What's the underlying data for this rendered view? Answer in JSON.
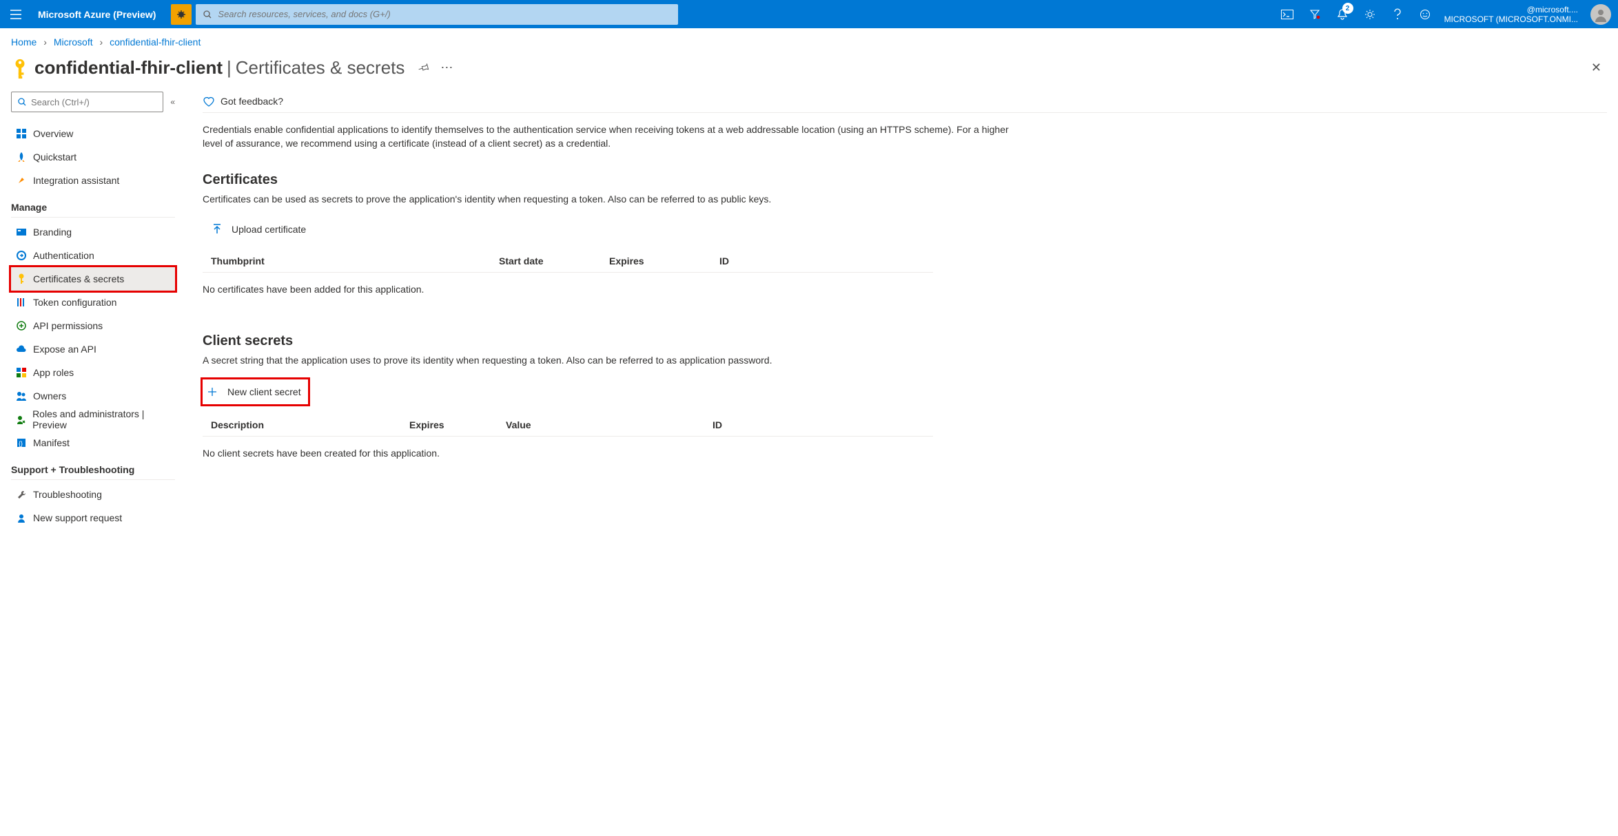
{
  "topbar": {
    "brand": "Microsoft Azure (Preview)",
    "search_placeholder": "Search resources, services, and docs (G+/)",
    "notification_count": "2",
    "account_line1": "@microsoft....",
    "account_line2": "MICROSOFT (MICROSOFT.ONMI..."
  },
  "breadcrumb": {
    "items": [
      "Home",
      "Microsoft",
      "confidential-fhir-client"
    ]
  },
  "header": {
    "title": "confidential-fhir-client",
    "subtitle": "Certificates & secrets"
  },
  "sidebar": {
    "search_placeholder": "Search (Ctrl+/)",
    "top_items": [
      {
        "label": "Overview"
      },
      {
        "label": "Quickstart"
      },
      {
        "label": "Integration assistant"
      }
    ],
    "section_manage": "Manage",
    "manage_items": [
      {
        "label": "Branding"
      },
      {
        "label": "Authentication"
      },
      {
        "label": "Certificates & secrets"
      },
      {
        "label": "Token configuration"
      },
      {
        "label": "API permissions"
      },
      {
        "label": "Expose an API"
      },
      {
        "label": "App roles"
      },
      {
        "label": "Owners"
      },
      {
        "label": "Roles and administrators | Preview"
      },
      {
        "label": "Manifest"
      }
    ],
    "section_support": "Support + Troubleshooting",
    "support_items": [
      {
        "label": "Troubleshooting"
      },
      {
        "label": "New support request"
      }
    ]
  },
  "main": {
    "feedback_label": "Got feedback?",
    "intro_text": "Credentials enable confidential applications to identify themselves to the authentication service when receiving tokens at a web addressable location (using an HTTPS scheme). For a higher level of assurance, we recommend using a certificate (instead of a client secret) as a credential.",
    "cert_heading": "Certificates",
    "cert_desc": "Certificates can be used as secrets to prove the application's identity when requesting a token. Also can be referred to as public keys.",
    "upload_cert_label": "Upload certificate",
    "cert_table": {
      "thumbprint": "Thumbprint",
      "start": "Start date",
      "expires": "Expires",
      "id": "ID"
    },
    "cert_empty": "No certificates have been added for this application.",
    "secrets_heading": "Client secrets",
    "secrets_desc": "A secret string that the application uses to prove its identity when requesting a token. Also can be referred to as application password.",
    "new_secret_label": "New client secret",
    "secrets_table": {
      "desc": "Description",
      "expires": "Expires",
      "value": "Value",
      "id": "ID"
    },
    "secrets_empty": "No client secrets have been created for this application."
  }
}
